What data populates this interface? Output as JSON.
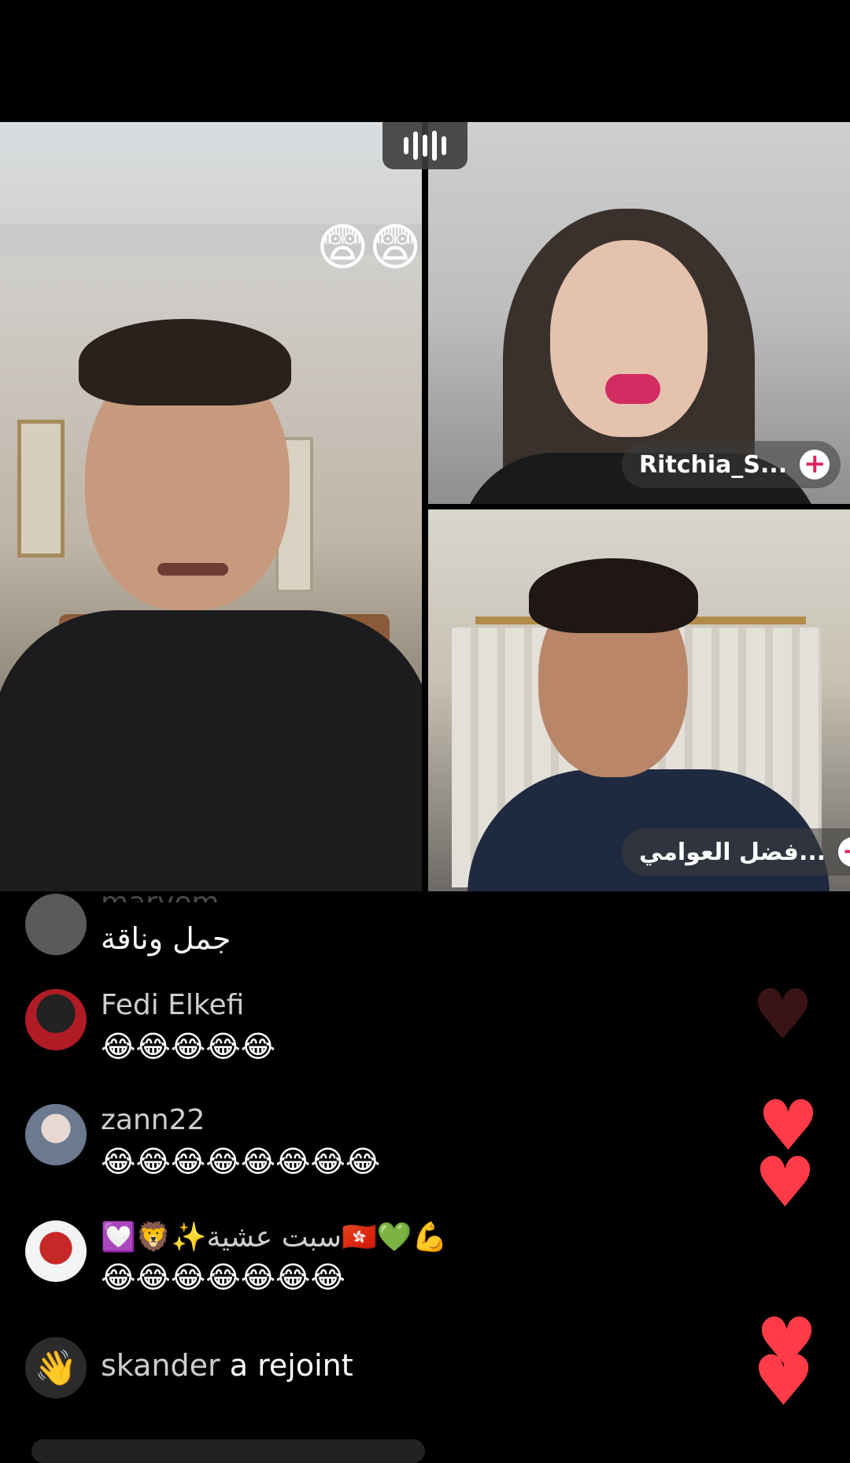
{
  "live": {
    "reaction_emojis": "😨😨",
    "guest1_name": "Ritchia_S...",
    "guest2_name": "فضل العوامي..."
  },
  "comments": [
    {
      "user": "maryem",
      "message": "جمل وناقة"
    },
    {
      "user": "Fedi Elkefi",
      "message": "😂😂😂😂😂"
    },
    {
      "user": "zann22",
      "message": "😂😂😂😂😂😂😂😂"
    },
    {
      "user": "💟🦁✨سبت عشية🇭🇰💚💪",
      "message": "😂😂😂😂😂😂😂"
    }
  ],
  "join_event": {
    "user": "skander",
    "text": "a rejoint"
  },
  "colors": {
    "heart": "#ff3b47",
    "plus": "#e0245e"
  },
  "icons": {
    "join": "waving-hand-icon",
    "speaker": "audio-level-icon"
  }
}
